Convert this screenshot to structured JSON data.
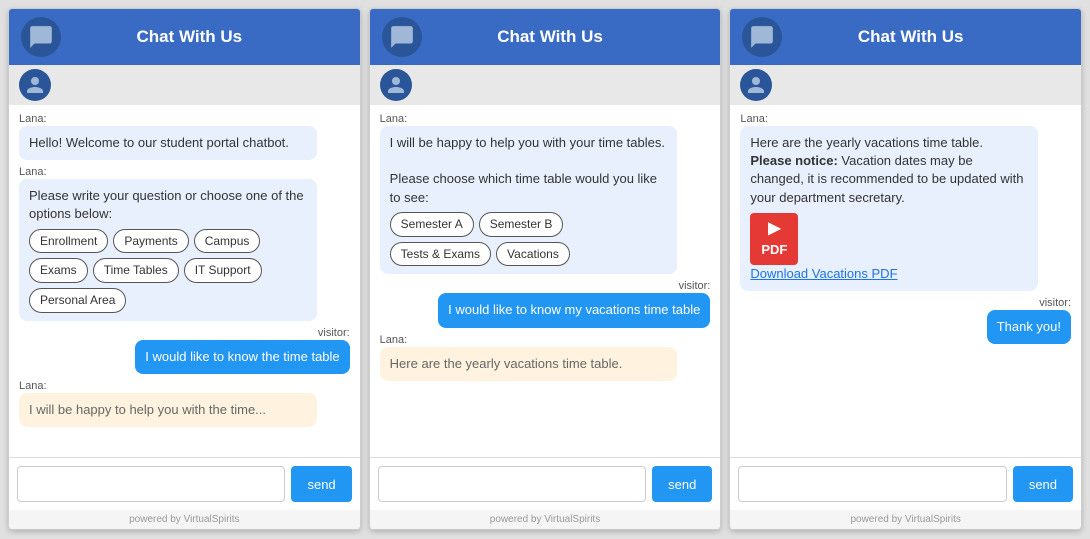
{
  "header": {
    "title": "Chat With Us"
  },
  "panels": [
    {
      "id": "panel1",
      "header_title": "Chat With Us",
      "messages": [
        {
          "sender": "Lana",
          "type": "bot",
          "text": "Hello! Welcome to our student portal chatbot."
        },
        {
          "sender": "Lana",
          "type": "bot",
          "text": "Please write your question or choose one of the options below:",
          "chips": [
            "Enrollment",
            "Payments",
            "Campus",
            "Exams",
            "Time Tables",
            "IT Support",
            "Personal Area"
          ]
        },
        {
          "sender": "visitor",
          "type": "visitor",
          "text": "I would like to know the time table"
        },
        {
          "sender": "Lana",
          "type": "bot_partial",
          "text": "I will be happy to help you with the time..."
        }
      ],
      "input_placeholder": "",
      "send_label": "send",
      "powered_by": "powered by VirtualSpirits"
    },
    {
      "id": "panel2",
      "header_title": "Chat With Us",
      "messages": [
        {
          "sender": "Lana",
          "type": "bot",
          "text": "I will be happy to help you with your time tables.\n\nPlease choose which time table would you like to see:",
          "chips": [
            "Semester A",
            "Semester B",
            "Tests & Exams",
            "Vacations"
          ]
        },
        {
          "sender": "visitor",
          "type": "visitor",
          "text": "I would like to know my vacations time table"
        },
        {
          "sender": "Lana",
          "type": "bot_partial",
          "text": "Here are the yearly vacations time table."
        }
      ],
      "input_placeholder": "",
      "send_label": "send",
      "powered_by": "powered by VirtualSpirits"
    },
    {
      "id": "panel3",
      "header_title": "Chat With Us",
      "messages": [
        {
          "sender": "Lana",
          "type": "bot",
          "text": "Here are the yearly vacations time table.",
          "notice_bold": "Please notice:",
          "notice_text": " Vacation dates may be changed, it is recommended to be updated with your department secretary.",
          "has_pdf": true,
          "pdf_link": "Download Vacations PDF"
        },
        {
          "sender": "visitor",
          "type": "visitor",
          "text": "Thank you!"
        }
      ],
      "input_placeholder": "",
      "send_label": "send",
      "powered_by": "powered by VirtualSpirits"
    }
  ]
}
